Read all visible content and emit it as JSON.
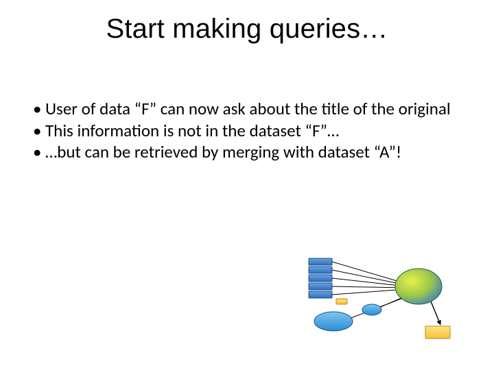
{
  "title": "Start making queries…",
  "bullets": [
    "User of data “F” can now ask about the title of the original",
    "This information is not in the dataset “F”…",
    "…but can be retrieved by merging with dataset “A”!"
  ]
}
